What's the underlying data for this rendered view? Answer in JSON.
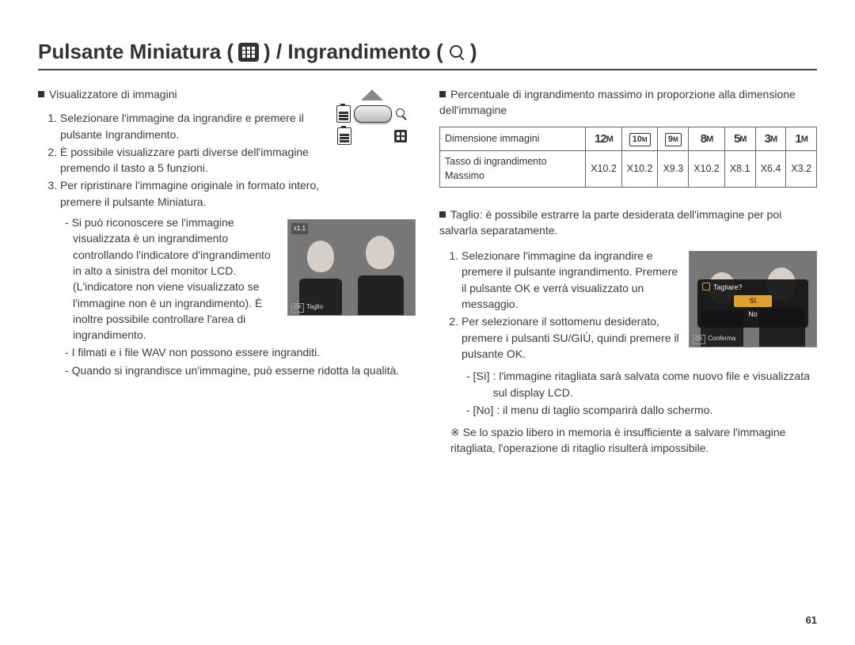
{
  "title": {
    "part1": "Pulsante Miniatura (",
    "part2": ") / Ingrandimento (",
    "part3": ")"
  },
  "left": {
    "heading": "Visualizzatore di immagini",
    "steps": [
      "Selezionare l'immagine da ingrandire e premere il pulsante Ingrandimento.",
      "È possibile visualizzare parti diverse dell'immagine premendo il tasto a 5 funzioni.",
      "Per ripristinare l'immagine originale in formato intero, premere il pulsante Miniatura."
    ],
    "dashes": [
      "Si può riconoscere se l'immagine visualizzata è un ingrandimento controllando l'indicatore d'ingrandimento in alto a sinistra del monitor LCD. (L'indicatore non viene visualizzato se l'immagine non è un ingrandimento). È inoltre possibile controllare l'area di ingrandimento.",
      "I filmati e i file WAV non possono essere ingranditi.",
      "Quando si ingrandisce un'immagine, può esserne ridotta la qualità."
    ],
    "photo1": {
      "overlay": "x1.1",
      "caption_btn": "OK",
      "caption": "Taglio"
    }
  },
  "right": {
    "heading": "Percentuale di ingrandimento massimo in proporzione alla dimensione dell'immagine",
    "table": {
      "row1_label": "Dimensione immagini",
      "row2_label": "Tasso di ingrandimento Massimo",
      "dims": [
        "12",
        "10",
        "9",
        "8",
        "5",
        "3",
        "1"
      ],
      "boxed": [
        false,
        true,
        true,
        false,
        false,
        false,
        false
      ],
      "rates": [
        "X10.2",
        "X10.2",
        "X9.3",
        "X10.2",
        "X8.1",
        "X6.4",
        "X3.2"
      ]
    },
    "crop_heading": "Taglio: è possibile estrarre la parte desiderata dell'immagine per poi salvarla separatamente.",
    "crop_steps": [
      "Selezionare l'immagine da ingrandire e premere il pulsante ingrandimento. Premere il pulsante OK e verrà visualizzato un messaggio.",
      "Per selezionare il sottomenu desiderato, premere i pulsanti SU/GIÙ, quindi premere il pulsante OK."
    ],
    "opts": {
      "si_label": "- [Sì]",
      "si_text": ": l'immagine ritagliata sarà salvata come nuovo file e visualizzata sul display LCD.",
      "no_label": "- [No]",
      "no_text": ": il menu di taglio scomparirà dallo schermo."
    },
    "note": "Se lo spazio libero in memoria è insufficiente a salvare l'immagine ritagliata, l'operazione di ritaglio risulterà impossibile.",
    "photo2": {
      "dialog_title": "Tagliare?",
      "opt_si": "Sì",
      "opt_no": "No",
      "caption_btn": "OK",
      "caption": "Conferma"
    }
  },
  "page_number": "61"
}
